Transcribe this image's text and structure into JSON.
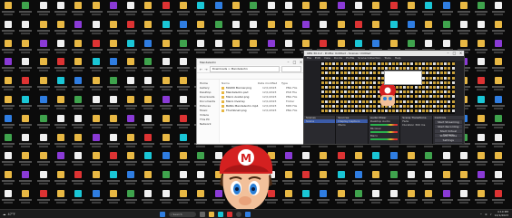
{
  "explorer": {
    "title": "Mendelsohn",
    "address": "Downloads > Mendelsohn",
    "nav_items": [
      "Home",
      "Gallery",
      "Desktop",
      "Downloads",
      "Documents",
      "Pictures",
      "Music",
      "Videos",
      "This PC",
      "Network"
    ],
    "columns": [
      "Name",
      "Date modified",
      "Type"
    ],
    "files": [
      {
        "name": "MARIO Banner.png",
        "date": "12/1/2023",
        "type": "PNG File"
      },
      {
        "name": "Mendelsohn.psd",
        "date": "12/1/2023",
        "type": "PSD File"
      },
      {
        "name": "Mario Avatar.png",
        "date": "12/1/2023",
        "type": "PNG File"
      },
      {
        "name": "Mario Overlay",
        "date": "12/1/2023",
        "type": "Folder"
      },
      {
        "name": "BANG Mendelsohn.mp4",
        "date": "12/1/2023",
        "type": "MP4 File"
      },
      {
        "name": "Thumbnail.png",
        "date": "12/1/2023",
        "type": "PNG File"
      }
    ]
  },
  "obs": {
    "title": "OBS 30.0.2 - Profile: Untitled - Scenes: Untitled",
    "menu": [
      "File",
      "Edit",
      "View",
      "Docks",
      "Profile",
      "Scene Collection",
      "Tools",
      "Help"
    ],
    "docks": [
      {
        "title": "Scenes",
        "items": [
          "Scene"
        ]
      },
      {
        "title": "Sources",
        "items": [
          "Display Capture",
          "Mario"
        ]
      },
      {
        "title": "Audio Mixer",
        "items": [
          "Desktop Audio",
          "Mic/Aux",
          "Mario"
        ]
      },
      {
        "title": "Scene Transitions",
        "items": [
          "Fade",
          "Duration 300 ms"
        ]
      },
      {
        "title": "Controls",
        "items": [
          "Start Streaming",
          "Start Recording",
          "Start Virtual Camera",
          "Studio Mode",
          "Settings",
          "Exit"
        ]
      }
    ]
  },
  "taskbar": {
    "weather_temp": "47°F",
    "weather_desc": "Cloudy",
    "search_placeholder": "Search",
    "time": "4:10 PM",
    "date": "12/1/2023"
  },
  "colors": {
    "folder": "#e8b844",
    "desktop_bg": "#0b0b0b",
    "obs_bg": "#1f1f23",
    "accent": "#2f7de1"
  }
}
